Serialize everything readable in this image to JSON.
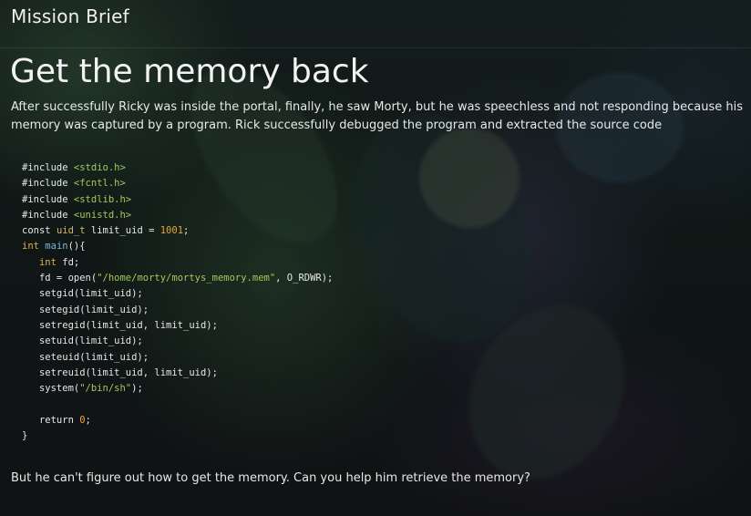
{
  "header": {
    "title": "Mission Brief"
  },
  "main": {
    "title": "Get the memory back",
    "intro": "After successfully Ricky was inside the portal, finally, he saw Morty, but he was speechless and not responding because his memory was captured by a program. Rick successfully debugged the program and extracted the source code",
    "code": {
      "lines": [
        {
          "parts": [
            {
              "t": "#include ",
              "c": ""
            },
            {
              "t": "<stdio.h>",
              "c": "str"
            }
          ]
        },
        {
          "parts": [
            {
              "t": "#include ",
              "c": ""
            },
            {
              "t": "<fcntl.h>",
              "c": "str"
            }
          ]
        },
        {
          "parts": [
            {
              "t": "#include ",
              "c": ""
            },
            {
              "t": "<stdlib.h>",
              "c": "str"
            }
          ]
        },
        {
          "parts": [
            {
              "t": "#include ",
              "c": ""
            },
            {
              "t": "<unistd.h>",
              "c": "str"
            }
          ]
        },
        {
          "parts": [
            {
              "t": "const ",
              "c": ""
            },
            {
              "t": "uid_t",
              "c": "typ"
            },
            {
              "t": " limit_uid = ",
              "c": ""
            },
            {
              "t": "1001",
              "c": "num"
            },
            {
              "t": ";",
              "c": ""
            }
          ]
        },
        {
          "parts": [
            {
              "t": "int ",
              "c": "kw"
            },
            {
              "t": "main",
              "c": "fn"
            },
            {
              "t": "(){",
              "c": ""
            }
          ]
        },
        {
          "parts": [
            {
              "t": "   ",
              "c": ""
            },
            {
              "t": "int",
              "c": "kw"
            },
            {
              "t": " fd;",
              "c": ""
            }
          ]
        },
        {
          "parts": [
            {
              "t": "   fd = open(",
              "c": ""
            },
            {
              "t": "\"/home/morty/mortys_memory.mem\"",
              "c": "str"
            },
            {
              "t": ", O_RDWR);",
              "c": ""
            }
          ]
        },
        {
          "parts": [
            {
              "t": "   setgid(limit_uid);",
              "c": ""
            }
          ]
        },
        {
          "parts": [
            {
              "t": "   setegid(limit_uid);",
              "c": ""
            }
          ]
        },
        {
          "parts": [
            {
              "t": "   setregid(limit_uid, limit_uid);",
              "c": ""
            }
          ]
        },
        {
          "parts": [
            {
              "t": "   setuid(limit_uid);",
              "c": ""
            }
          ]
        },
        {
          "parts": [
            {
              "t": "   seteuid(limit_uid);",
              "c": ""
            }
          ]
        },
        {
          "parts": [
            {
              "t": "   setreuid(limit_uid, limit_uid);",
              "c": ""
            }
          ]
        },
        {
          "parts": [
            {
              "t": "   system(",
              "c": ""
            },
            {
              "t": "\"/bin/sh\"",
              "c": "str"
            },
            {
              "t": ");",
              "c": ""
            }
          ]
        },
        {
          "parts": [
            {
              "t": "",
              "c": ""
            }
          ]
        },
        {
          "parts": [
            {
              "t": "   return ",
              "c": ""
            },
            {
              "t": "0",
              "c": "num"
            },
            {
              "t": ";",
              "c": ""
            }
          ]
        },
        {
          "parts": [
            {
              "t": "}",
              "c": ""
            }
          ]
        }
      ]
    },
    "outro": "But he can't figure out how to get the memory. Can you help him retrieve the memory?"
  },
  "colors": {
    "background": "#131c1a",
    "text": "#e8e8e8",
    "string": "#a3c95a",
    "number": "#e3a53b",
    "keyword": "#e0b04a",
    "function": "#7fb6d8"
  }
}
